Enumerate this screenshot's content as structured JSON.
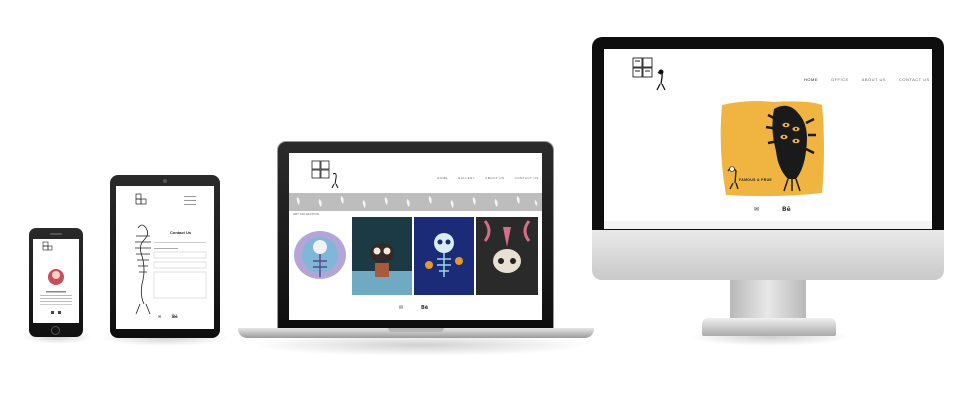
{
  "desktop": {
    "nav": [
      "HOME",
      "OFFICE",
      "ABOUT US",
      "CONTACT US"
    ],
    "hero_caption": "FAMOUS & PRUE",
    "social_icons": [
      "email-icon",
      "behance-icon"
    ],
    "social_labels": [
      "✉",
      "Bē"
    ]
  },
  "laptop": {
    "nav": [
      "HOME",
      "GALLERY",
      "ABOUT US",
      "CONTACT US"
    ],
    "section_label": "ART COLLECTION",
    "social_labels": [
      "✉",
      "Bē"
    ]
  },
  "tablet": {
    "heading": "Contact Us",
    "social_labels": [
      "✉",
      "Bē"
    ]
  },
  "colors": {
    "hero_yellow": "#f0b440",
    "art_navy": "#1b2b78",
    "art_blue": "#2a78a8",
    "art_dark": "#2a2a2a",
    "pattern_bg": "#bdbdbd"
  }
}
